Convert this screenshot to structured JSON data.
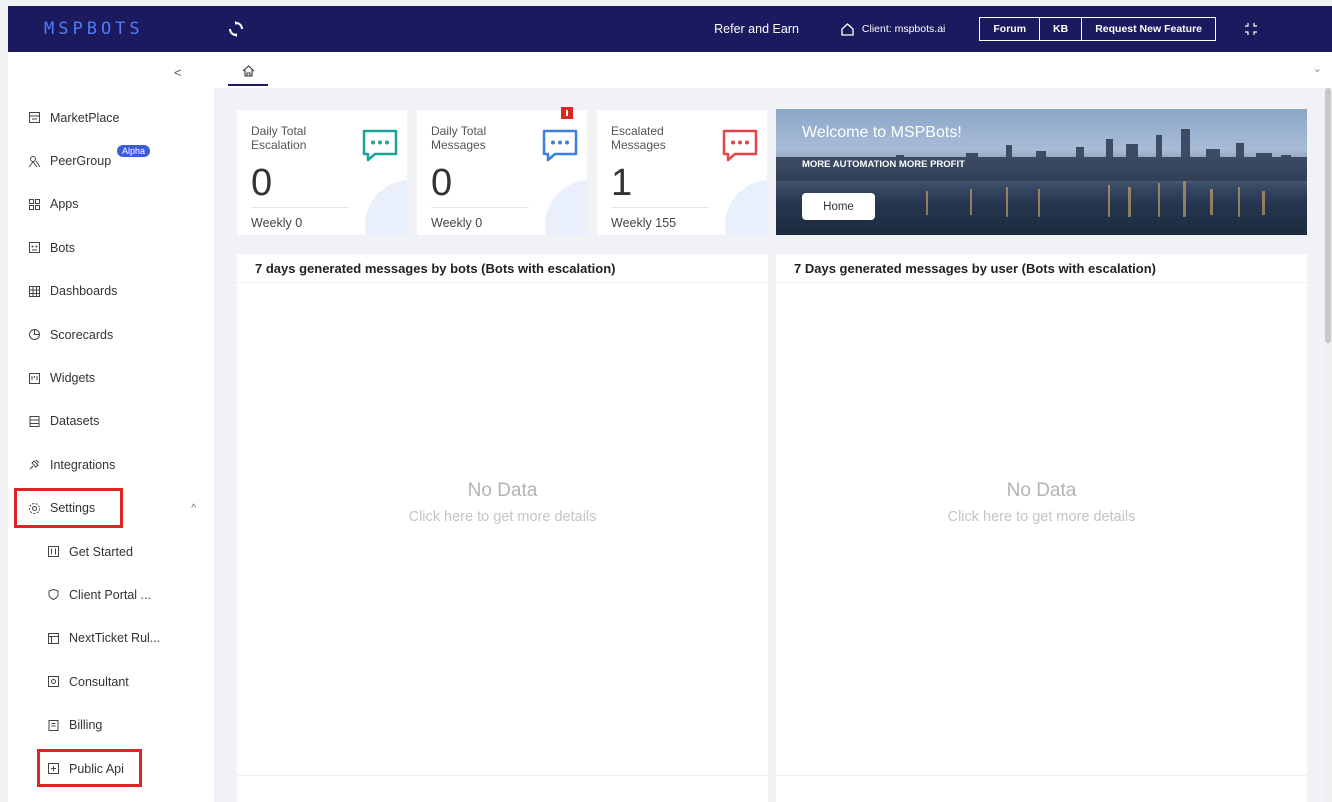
{
  "header": {
    "logo": "MSPBOTS",
    "refer": "Refer and Earn",
    "client": "Client: mspbots.ai",
    "buttons": [
      "Forum",
      "KB",
      "Request New Feature"
    ]
  },
  "sidebar": {
    "alpha_badge": "Alpha",
    "items": [
      {
        "label": "MarketPlace"
      },
      {
        "label": "PeerGroup"
      },
      {
        "label": "Apps"
      },
      {
        "label": "Bots"
      },
      {
        "label": "Dashboards"
      },
      {
        "label": "Scorecards"
      },
      {
        "label": "Widgets"
      },
      {
        "label": "Datasets"
      },
      {
        "label": "Integrations"
      },
      {
        "label": "Settings"
      }
    ],
    "sub_items": [
      {
        "label": "Get Started"
      },
      {
        "label": "Client Portal ..."
      },
      {
        "label": "NextTicket Rul..."
      },
      {
        "label": "Consultant"
      },
      {
        "label": "Billing"
      },
      {
        "label": "Public Api"
      }
    ]
  },
  "stats": [
    {
      "title": "Daily Total Escalation",
      "value": "0",
      "weekly_label": "Weekly",
      "weekly_value": "0",
      "color": "#1aa39a"
    },
    {
      "title": "Daily Total Messages",
      "value": "0",
      "weekly_label": "Weekly",
      "weekly_value": "0",
      "color": "#3b7fe0"
    },
    {
      "title": "Escalated Messages",
      "value": "1",
      "weekly_label": "Weekly",
      "weekly_value": "155",
      "color": "#e0474c"
    }
  ],
  "banner": {
    "welcome": "Welcome to MSPBots!",
    "tagline": "MORE AUTOMATION MORE PROFIT",
    "button": "Home"
  },
  "panels": [
    {
      "title": "7 days generated messages by bots (Bots with escalation)",
      "empty": "No Data",
      "hint": "Click here to get more details"
    },
    {
      "title": "7 Days generated messages by user (Bots with escalation)",
      "empty": "No Data",
      "hint": "Click here to get more details"
    }
  ]
}
